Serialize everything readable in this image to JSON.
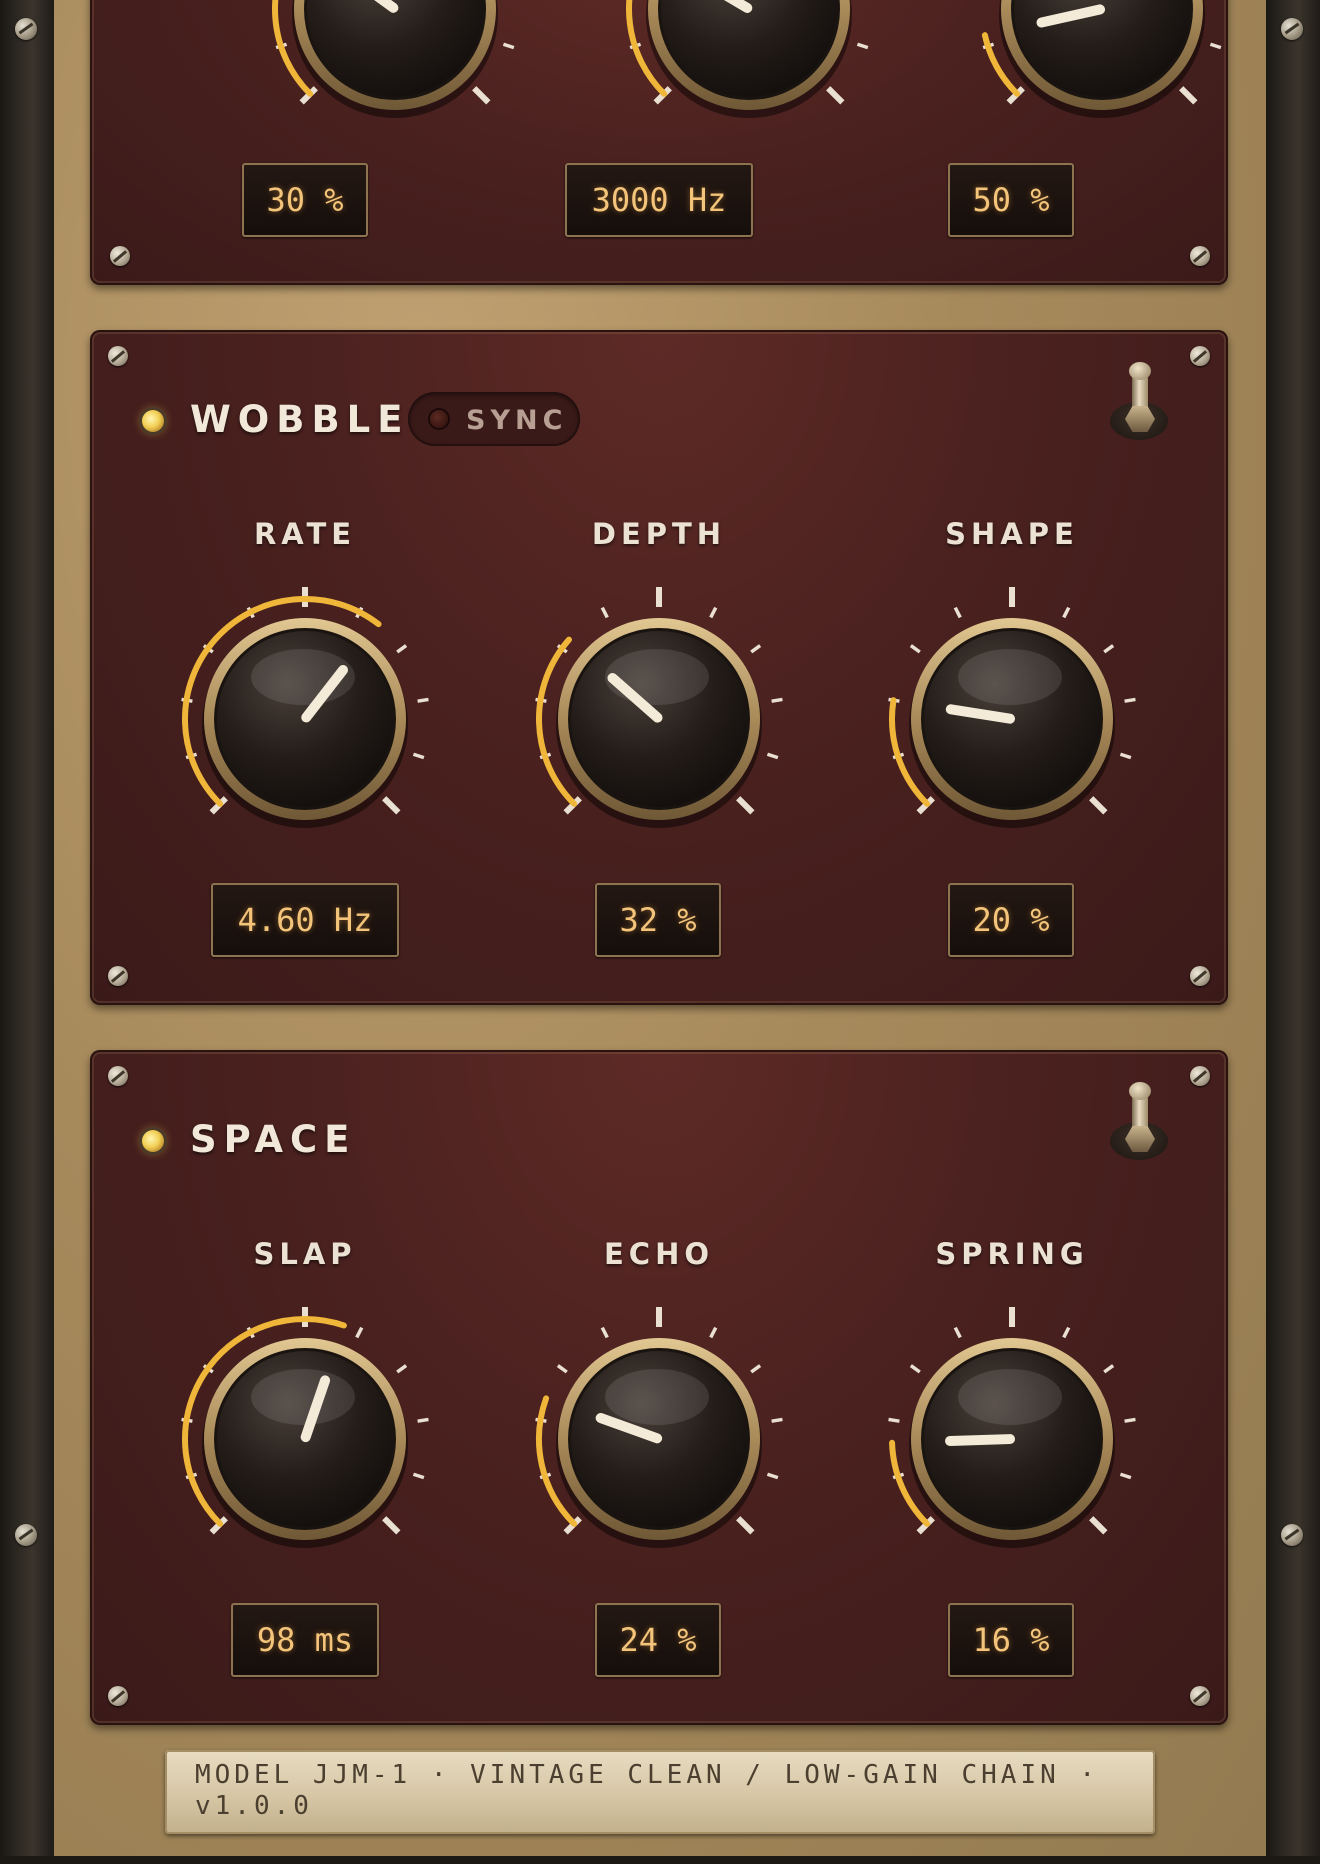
{
  "sections": [
    {
      "id": "top",
      "title": "",
      "knobs": [
        {
          "label": "",
          "readout": "30 %",
          "value": 0.3
        },
        {
          "label": "",
          "readout": "3000 Hz",
          "value": 0.28
        },
        {
          "label": "",
          "readout": "50 %",
          "value": 0.12
        }
      ]
    },
    {
      "id": "wobble",
      "title": "WOBBLE",
      "sync_label": "SYNC",
      "led_on": true,
      "knobs": [
        {
          "label": "RATE",
          "readout": "4.60 Hz",
          "value": 0.64
        },
        {
          "label": "DEPTH",
          "readout": "32 %",
          "value": 0.32
        },
        {
          "label": "SHAPE",
          "readout": "20 %",
          "value": 0.2
        }
      ]
    },
    {
      "id": "space",
      "title": "SPACE",
      "led_on": true,
      "knobs": [
        {
          "label": "SLAP",
          "readout": "98 ms",
          "value": 0.57
        },
        {
          "label": "ECHO",
          "readout": "24 %",
          "value": 0.24
        },
        {
          "label": "SPRING",
          "readout": "16 %",
          "value": 0.16
        }
      ]
    }
  ],
  "footer": {
    "text": "MODEL JJM-1  ·  VINTAGE CLEAN / LOW-GAIN CHAIN  ·  v1.0.0"
  },
  "colors": {
    "arc": "#f0b63a",
    "pointer": "#f4ead8",
    "readout_text": "#f3c47a",
    "panel": "#4a211f"
  }
}
